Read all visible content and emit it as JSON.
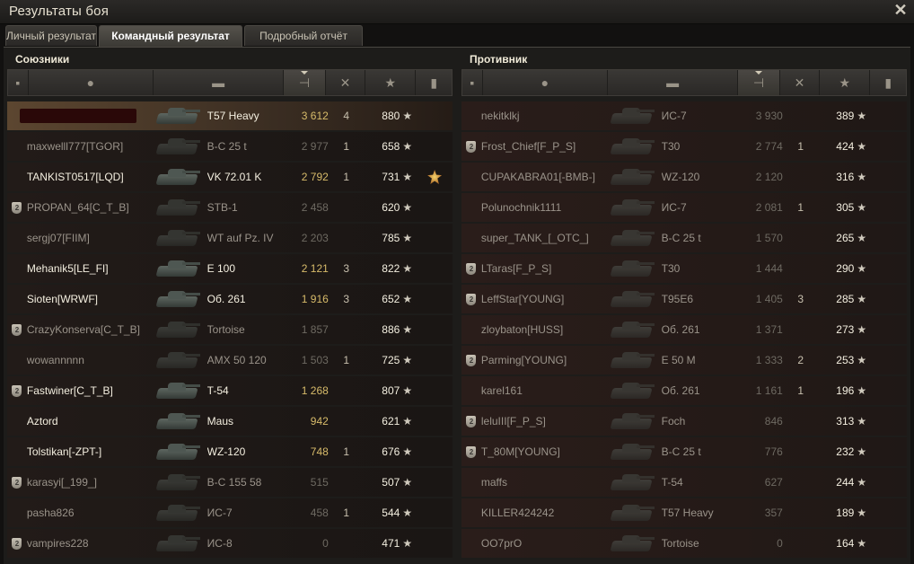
{
  "window": {
    "title": "Результаты боя",
    "close_label": "✕"
  },
  "tabs": [
    {
      "label": "Личный результат",
      "active": false
    },
    {
      "label": "Командный результат",
      "active": true
    },
    {
      "label": "Подробный отчёт",
      "active": false
    }
  ],
  "allies": {
    "title": "Союзники",
    "rows": [
      {
        "player": "████████████",
        "vehicle": "T57 Heavy",
        "damage": "3 612",
        "kills": "4",
        "xp": "880",
        "alive": true,
        "badge": false,
        "highlight": true,
        "redacted": true
      },
      {
        "player": "maxwelll777[TGOR]",
        "vehicle": "B-C 25 t",
        "damage": "2 977",
        "kills": "1",
        "xp": "658",
        "alive": false,
        "badge": false
      },
      {
        "player": "TANKIST0517[LQD]",
        "vehicle": "VK 72.01 K",
        "damage": "2 792",
        "kills": "1",
        "xp": "731",
        "alive": true,
        "badge": false,
        "medal": true
      },
      {
        "player": "PROPAN_64[C_T_B]",
        "vehicle": "STB-1",
        "damage": "2 458",
        "kills": "",
        "xp": "620",
        "alive": false,
        "badge": true
      },
      {
        "player": "sergj07[FIIM]",
        "vehicle": "WT auf Pz. IV",
        "damage": "2 203",
        "kills": "",
        "xp": "785",
        "alive": false,
        "badge": false
      },
      {
        "player": "Mehanik5[LE_FI]",
        "vehicle": "E 100",
        "damage": "2 121",
        "kills": "3",
        "xp": "822",
        "alive": true,
        "badge": false
      },
      {
        "player": "Sioten[WRWF]",
        "vehicle": "Об. 261",
        "damage": "1 916",
        "kills": "3",
        "xp": "652",
        "alive": true,
        "badge": false
      },
      {
        "player": "CrazyKonserva[C_T_B]",
        "vehicle": "Tortoise",
        "damage": "1 857",
        "kills": "",
        "xp": "886",
        "alive": false,
        "badge": true
      },
      {
        "player": "wowannnnn",
        "vehicle": "AMX 50 120",
        "damage": "1 503",
        "kills": "1",
        "xp": "725",
        "alive": false,
        "badge": false
      },
      {
        "player": "Fastwiner[C_T_B]",
        "vehicle": "T-54",
        "damage": "1 268",
        "kills": "",
        "xp": "807",
        "alive": true,
        "badge": true
      },
      {
        "player": "Aztord",
        "vehicle": "Maus",
        "damage": "942",
        "kills": "",
        "xp": "621",
        "alive": true,
        "badge": false
      },
      {
        "player": "Tolstikan[-ZPT-]",
        "vehicle": "WZ-120",
        "damage": "748",
        "kills": "1",
        "xp": "676",
        "alive": true,
        "badge": false
      },
      {
        "player": "karasyi[_199_]",
        "vehicle": "B-C 155 58",
        "damage": "515",
        "kills": "",
        "xp": "507",
        "alive": false,
        "badge": true
      },
      {
        "player": "pasha826",
        "vehicle": "ИС-7",
        "damage": "458",
        "kills": "1",
        "xp": "544",
        "alive": false,
        "badge": false
      },
      {
        "player": "vampires228",
        "vehicle": "ИС-8",
        "damage": "0",
        "kills": "",
        "xp": "471",
        "alive": false,
        "badge": true
      }
    ]
  },
  "enemies": {
    "title": "Противник",
    "rows": [
      {
        "player": "nekitklkj",
        "vehicle": "ИС-7",
        "damage": "3 930",
        "kills": "",
        "xp": "389",
        "alive": false,
        "badge": false
      },
      {
        "player": "Frost_Chief[F_P_S]",
        "vehicle": "T30",
        "damage": "2 774",
        "kills": "1",
        "xp": "424",
        "alive": false,
        "badge": true
      },
      {
        "player": "CUPAKABRA01[-BMB-]",
        "vehicle": "WZ-120",
        "damage": "2 120",
        "kills": "",
        "xp": "316",
        "alive": false,
        "badge": false
      },
      {
        "player": "Polunochnik1111",
        "vehicle": "ИС-7",
        "damage": "2 081",
        "kills": "1",
        "xp": "305",
        "alive": false,
        "badge": false
      },
      {
        "player": "super_TANK_[_OTC_]",
        "vehicle": "B-C 25 t",
        "damage": "1 570",
        "kills": "",
        "xp": "265",
        "alive": false,
        "badge": false
      },
      {
        "player": "LTaras[F_P_S]",
        "vehicle": "T30",
        "damage": "1 444",
        "kills": "",
        "xp": "290",
        "alive": false,
        "badge": true
      },
      {
        "player": "LeffStar[YOUNG]",
        "vehicle": "T95E6",
        "damage": "1 405",
        "kills": "3",
        "xp": "285",
        "alive": false,
        "badge": true
      },
      {
        "player": "zloybaton[HUSS]",
        "vehicle": "Об. 261",
        "damage": "1 371",
        "kills": "",
        "xp": "273",
        "alive": false,
        "badge": false
      },
      {
        "player": "Parming[YOUNG]",
        "vehicle": "E 50 M",
        "damage": "1 333",
        "kills": "2",
        "xp": "253",
        "alive": false,
        "badge": true
      },
      {
        "player": "karel161",
        "vehicle": "Об. 261",
        "damage": "1 161",
        "kills": "1",
        "xp": "196",
        "alive": false,
        "badge": false
      },
      {
        "player": "leluIII[F_P_S]",
        "vehicle": "Foch",
        "damage": "846",
        "kills": "",
        "xp": "313",
        "alive": false,
        "badge": true
      },
      {
        "player": "T_80M[YOUNG]",
        "vehicle": "B-C 25 t",
        "damage": "776",
        "kills": "",
        "xp": "232",
        "alive": false,
        "badge": true
      },
      {
        "player": "maffs",
        "vehicle": "T-54",
        "damage": "627",
        "kills": "",
        "xp": "244",
        "alive": false,
        "badge": false
      },
      {
        "player": "KILLER424242",
        "vehicle": "T57 Heavy",
        "damage": "357",
        "kills": "",
        "xp": "189",
        "alive": false,
        "badge": false
      },
      {
        "player": "OO7prO",
        "vehicle": "Tortoise",
        "damage": "0",
        "kills": "",
        "xp": "164",
        "alive": false,
        "badge": false
      }
    ]
  },
  "icons": {
    "star": "★",
    "badge": "2",
    "column_icons": [
      "platoon-icon",
      "player-icon",
      "tank-icon",
      "damage-icon",
      "kills-icon",
      "xp-icon",
      "medal-icon"
    ]
  }
}
